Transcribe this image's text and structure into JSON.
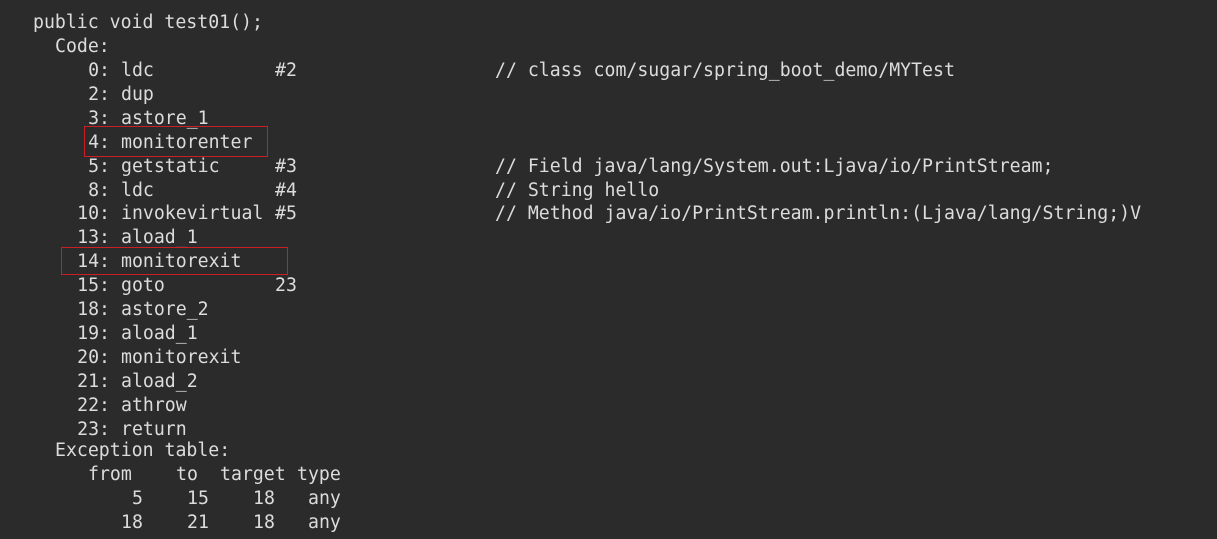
{
  "code_view": {
    "signature": "public void test01();",
    "code_label": "Code:",
    "instructions": [
      {
        "offset": "0:",
        "opcode": "ldc",
        "operand": "#2",
        "comment": "// class com/sugar/spring_boot_demo/MYTest"
      },
      {
        "offset": "2:",
        "opcode": "dup",
        "operand": "",
        "comment": ""
      },
      {
        "offset": "3:",
        "opcode": "astore_1",
        "operand": "",
        "comment": ""
      },
      {
        "offset": "4:",
        "opcode": "monitorenter",
        "operand": "",
        "comment": ""
      },
      {
        "offset": "5:",
        "opcode": "getstatic",
        "operand": "#3",
        "comment": "// Field java/lang/System.out:Ljava/io/PrintStream;"
      },
      {
        "offset": "8:",
        "opcode": "ldc",
        "operand": "#4",
        "comment": "// String hello"
      },
      {
        "offset": "10:",
        "opcode": "invokevirtual",
        "operand": "#5",
        "comment": "// Method java/io/PrintStream.println:(Ljava/lang/String;)V"
      },
      {
        "offset": "13:",
        "opcode": "aload_1",
        "operand": "",
        "comment": ""
      },
      {
        "offset": "14:",
        "opcode": "monitorexit",
        "operand": "",
        "comment": ""
      },
      {
        "offset": "15:",
        "opcode": "goto",
        "operand": "23",
        "comment": ""
      },
      {
        "offset": "18:",
        "opcode": "astore_2",
        "operand": "",
        "comment": ""
      },
      {
        "offset": "19:",
        "opcode": "aload_1",
        "operand": "",
        "comment": ""
      },
      {
        "offset": "20:",
        "opcode": "monitorexit",
        "operand": "",
        "comment": ""
      },
      {
        "offset": "21:",
        "opcode": "aload_2",
        "operand": "",
        "comment": ""
      },
      {
        "offset": "22:",
        "opcode": "athrow",
        "operand": "",
        "comment": ""
      },
      {
        "offset": "23:",
        "opcode": "return",
        "operand": "",
        "comment": ""
      }
    ],
    "exception_table": {
      "label": "Exception table:",
      "headers": [
        "from",
        "to",
        "target",
        "type"
      ],
      "rows": [
        [
          "5",
          "15",
          "18",
          "any"
        ],
        [
          "18",
          "21",
          "18",
          "any"
        ]
      ]
    }
  },
  "colors": {
    "background": "#2b2b2b",
    "text": "#dcdcdc",
    "highlight_border": "#c91f25"
  }
}
